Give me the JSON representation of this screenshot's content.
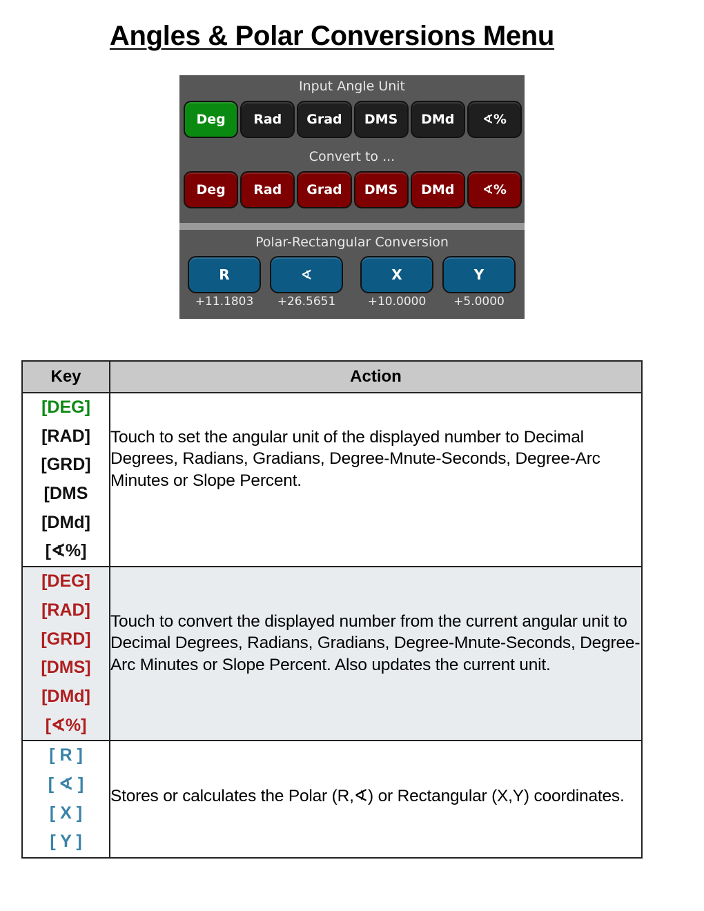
{
  "page": {
    "title": "Angles & Polar Conversions Menu"
  },
  "calculator": {
    "input_section_label": "Input Angle Unit",
    "input_buttons": [
      {
        "label": "Deg",
        "state": "selected"
      },
      {
        "label": "Rad"
      },
      {
        "label": "Grad"
      },
      {
        "label": "DMS"
      },
      {
        "label": "DMd"
      },
      {
        "label": "∢%"
      }
    ],
    "convert_section_label": "Convert to ...",
    "convert_buttons": [
      {
        "label": "Deg"
      },
      {
        "label": "Rad"
      },
      {
        "label": "Grad"
      },
      {
        "label": "DMS"
      },
      {
        "label": "DMd"
      },
      {
        "label": "∢%"
      }
    ],
    "polar_section_label": "Polar-Rectangular Conversion",
    "polar_buttons": [
      {
        "label": "R",
        "value": "+11.1803"
      },
      {
        "label": "∢",
        "value": "+26.5651"
      },
      {
        "label": "X",
        "value": "+10.0000"
      },
      {
        "label": "Y",
        "value": "+5.0000"
      }
    ],
    "colors": {
      "panel_bg": "#575757",
      "selected_green": "#0b8a12",
      "convert_red": "#7e0000",
      "polar_blue": "#0d5a85",
      "key_dark": "#1f1f1f"
    }
  },
  "table": {
    "headers": {
      "key": "Key",
      "action": "Action"
    },
    "rows": [
      {
        "keys": [
          "[DEG]",
          "[RAD]",
          "[GRD]",
          "[DMS",
          "[DMd]",
          "[∢%]"
        ],
        "action": "Touch to set the angular unit of the displayed number to Decimal Degrees, Radians, Gradians, Degree-Mnute-Seconds, Degree-Arc Minutes or Slope Percent."
      },
      {
        "keys": [
          "[DEG]",
          "[RAD]",
          "[GRD]",
          "[DMS]",
          "[DMd]",
          "[∢%]"
        ],
        "action": "Touch to convert the displayed number from the current angular unit to Decimal Degrees, Radians, Gradians, Degree-Mnute-Seconds, Degree-Arc Minutes or Slope Percent. Also updates the current unit."
      },
      {
        "keys": [
          "[ R ]",
          "[ ∢ ]",
          "[ X ]",
          "[ Y ]"
        ],
        "action": "Stores or calculates the Polar (R,∢) or Rectangular (X,Y) coordinates."
      }
    ],
    "colors": {
      "header_bg": "#c9c9c9",
      "alt_row_bg": "#e9ecef",
      "key_green": "#0b8a12",
      "key_red": "#b01e1e",
      "key_blue": "#3a83a8"
    }
  }
}
